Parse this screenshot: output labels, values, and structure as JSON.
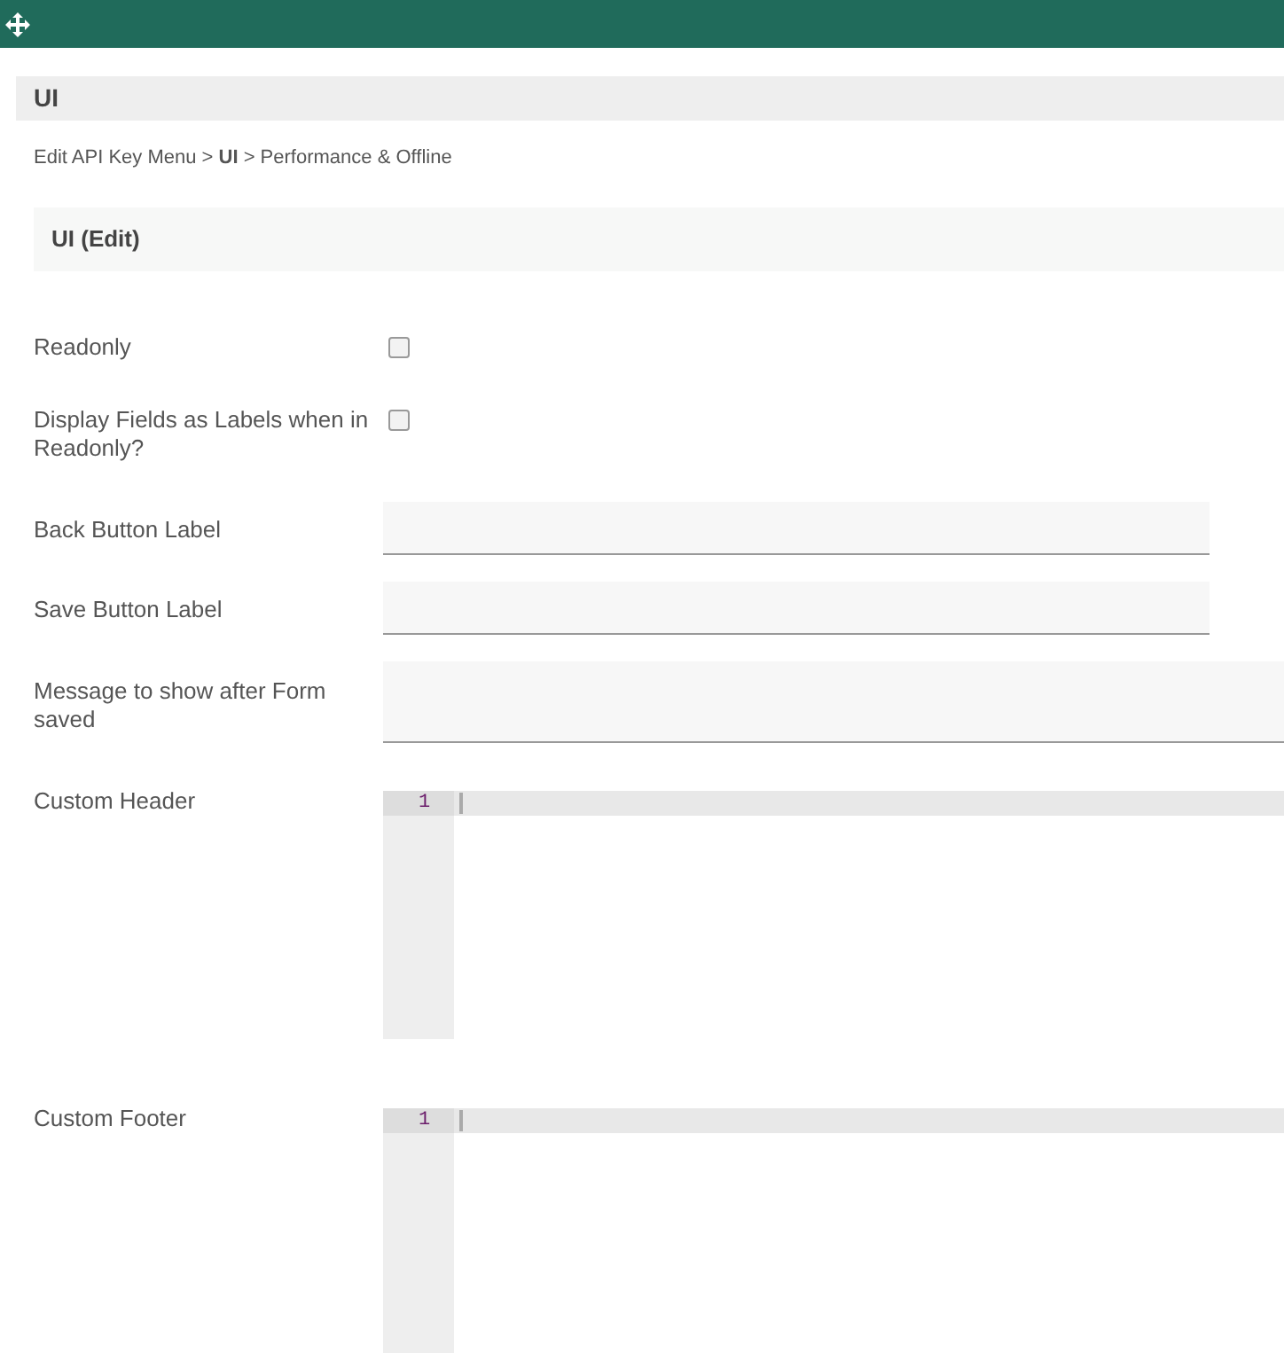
{
  "panel": {
    "title": "UI"
  },
  "breadcrumb": "Edit API Key Menu > **UI** > Performance & Offline",
  "section": {
    "title": "UI (Edit)"
  },
  "fields": [
    {
      "kind": "checkbox",
      "label": "Readonly",
      "checked": false
    },
    {
      "kind": "checkbox",
      "label": "Display Fields as Labels when in Readonly?",
      "checked": false
    },
    {
      "kind": "text",
      "label": "Back Button Label"
    },
    {
      "kind": "text",
      "label": "Save Button Label"
    },
    {
      "kind": "textarea",
      "label": "Message to show after Form saved"
    },
    {
      "kind": "code",
      "label": "Custom Header",
      "line_number": "1"
    },
    {
      "kind": "code",
      "label": "Custom Footer",
      "line_number": "1"
    }
  ]
}
